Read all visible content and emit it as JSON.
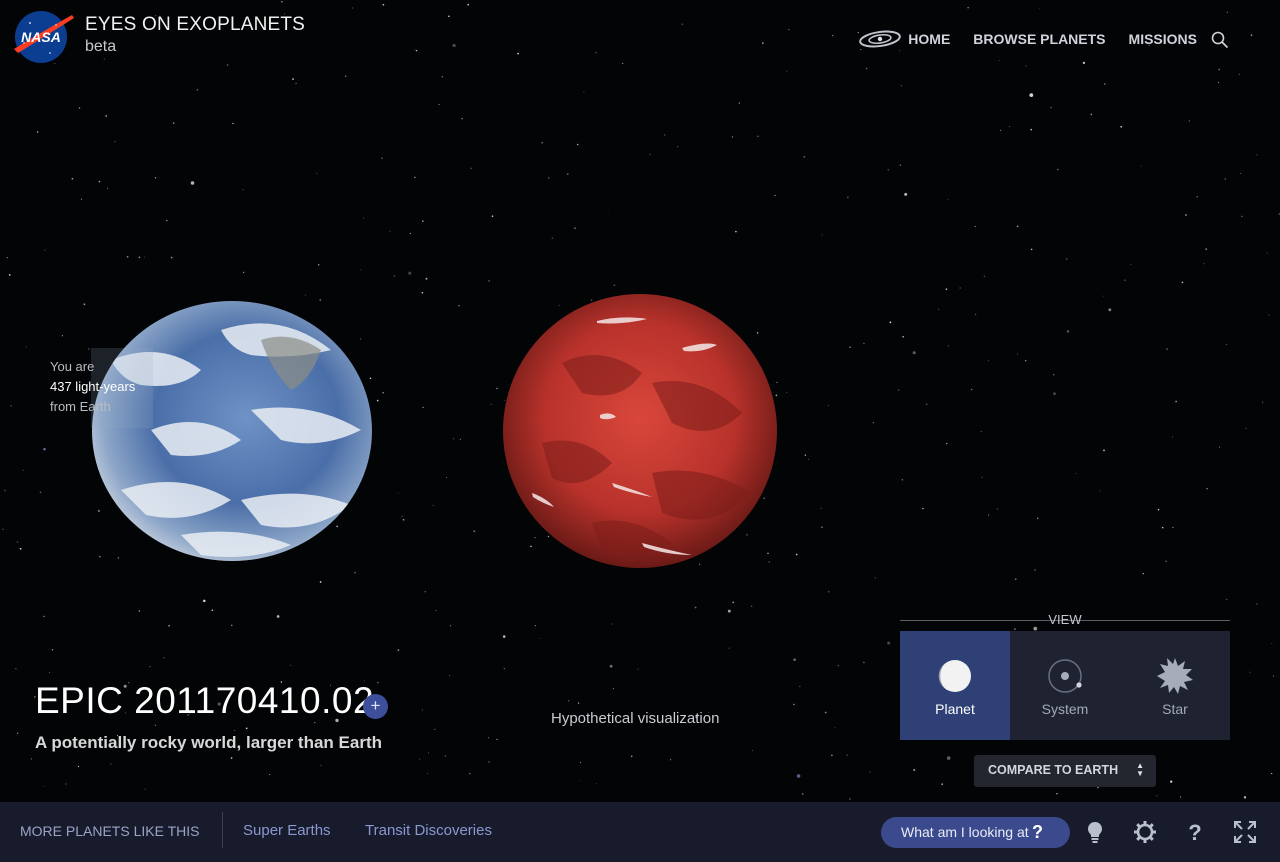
{
  "header": {
    "title": "EYES ON EXOPLANETS",
    "subtitle": "beta",
    "nav": [
      {
        "label": "HOME"
      },
      {
        "label": "BROWSE PLANETS"
      },
      {
        "label": "MISSIONS"
      }
    ]
  },
  "distance": {
    "line1": "You are",
    "value": "437 light-years",
    "line3": "from Earth"
  },
  "planet": {
    "name": "EPIC 201170410.02",
    "add_label": "+",
    "tagline": "A potentially rocky world, larger than Earth",
    "visual_note": "Hypothetical visualization"
  },
  "view": {
    "label": "VIEW",
    "options": [
      {
        "label": "Planet",
        "icon": "planet-icon",
        "active": true
      },
      {
        "label": "System",
        "icon": "system-icon",
        "active": false
      },
      {
        "label": "Star",
        "icon": "star-icon",
        "active": false
      }
    ],
    "compare": {
      "label": "COMPARE TO EARTH"
    }
  },
  "bottom_bar": {
    "more_label": "MORE PLANETS LIKE THIS",
    "links": [
      {
        "label": "Super Earths"
      },
      {
        "label": "Transit Discoveries"
      }
    ],
    "help_button": {
      "label": "What am I looking at",
      "icon": "?"
    },
    "tools": [
      "lightbulb-icon",
      "settings-icon",
      "help-icon",
      "fullscreen-icon"
    ]
  },
  "colors": {
    "background": "#030406",
    "accent": "#3b4a8c",
    "view_active": "#2f4076",
    "bottom_bar": "#171b2c",
    "exoplanet": "#b8322b"
  }
}
